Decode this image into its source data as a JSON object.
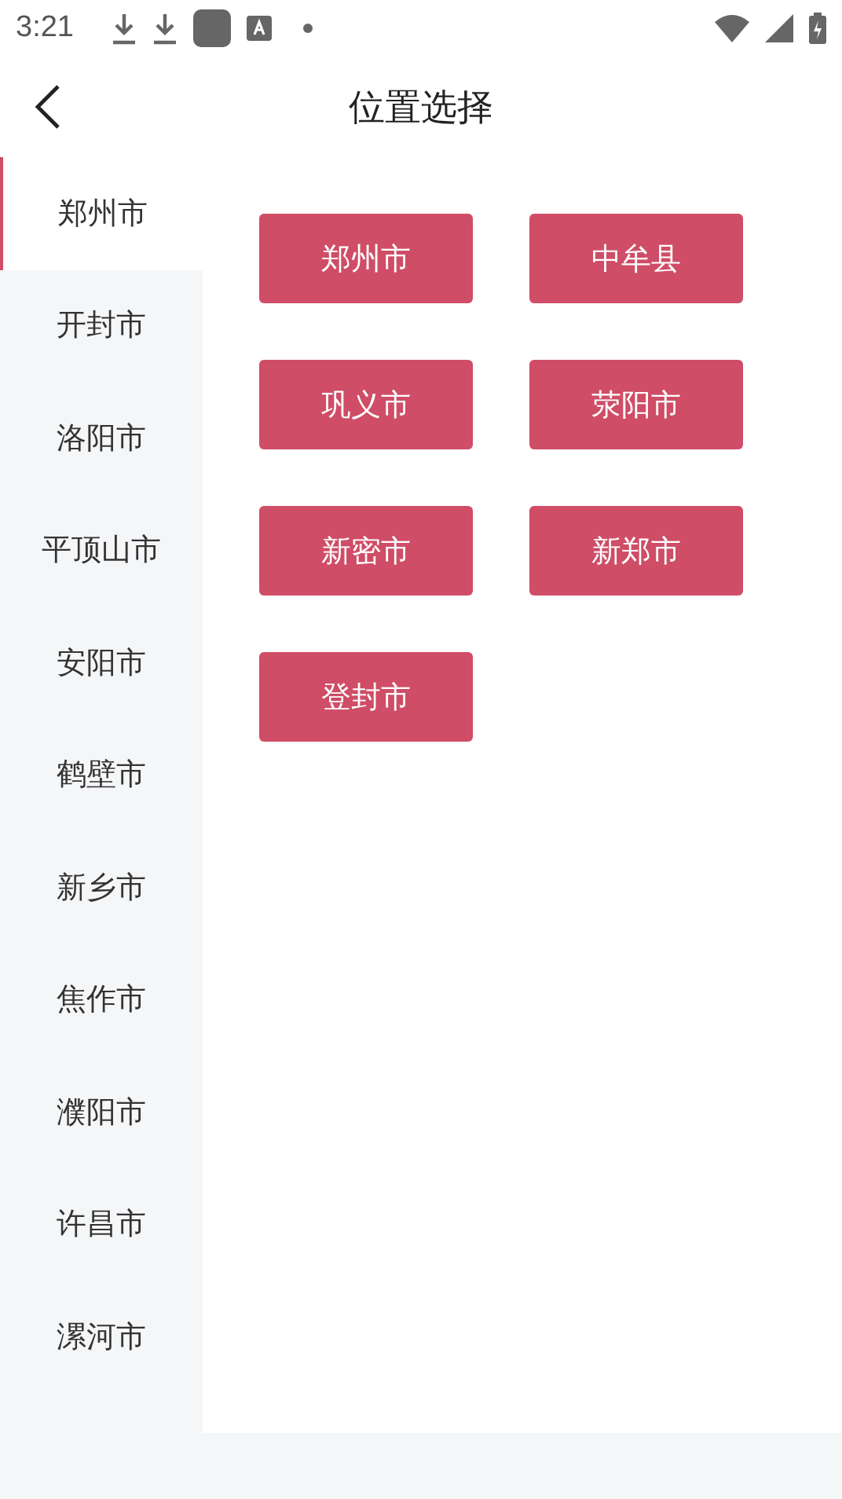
{
  "status_bar": {
    "time": "3:21"
  },
  "header": {
    "title": "位置选择"
  },
  "sidebar": {
    "items": [
      {
        "label": "郑州市",
        "selected": true
      },
      {
        "label": "开封市",
        "selected": false
      },
      {
        "label": "洛阳市",
        "selected": false
      },
      {
        "label": "平顶山市",
        "selected": false
      },
      {
        "label": "安阳市",
        "selected": false
      },
      {
        "label": "鹤壁市",
        "selected": false
      },
      {
        "label": "新乡市",
        "selected": false
      },
      {
        "label": "焦作市",
        "selected": false
      },
      {
        "label": "濮阳市",
        "selected": false
      },
      {
        "label": "许昌市",
        "selected": false
      },
      {
        "label": "漯河市",
        "selected": false
      }
    ]
  },
  "districts": [
    "郑州市",
    "中牟县",
    "巩义市",
    "荥阳市",
    "新密市",
    "新郑市",
    "登封市"
  ]
}
